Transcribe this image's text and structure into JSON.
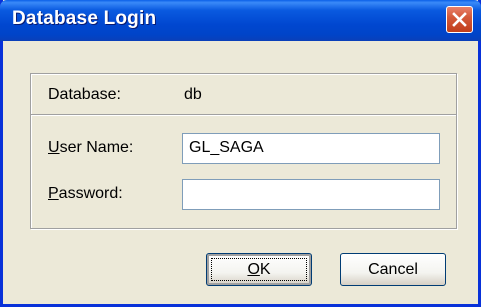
{
  "window": {
    "title": "Database Login"
  },
  "fields": {
    "database_label": "Database:",
    "database_value": "db",
    "username_label_first": "U",
    "username_label_rest": "ser Name:",
    "username_value": "GL_SAGA",
    "password_label_first": "P",
    "password_label_rest": "assword:",
    "password_value": ""
  },
  "buttons": {
    "ok_first": "O",
    "ok_rest": "K",
    "cancel": "Cancel"
  },
  "icons": {
    "close": "close-icon"
  },
  "colors": {
    "titlebar": "#0047d0",
    "close_button": "#c13e1a",
    "dialog_background": "#ece9d8"
  }
}
